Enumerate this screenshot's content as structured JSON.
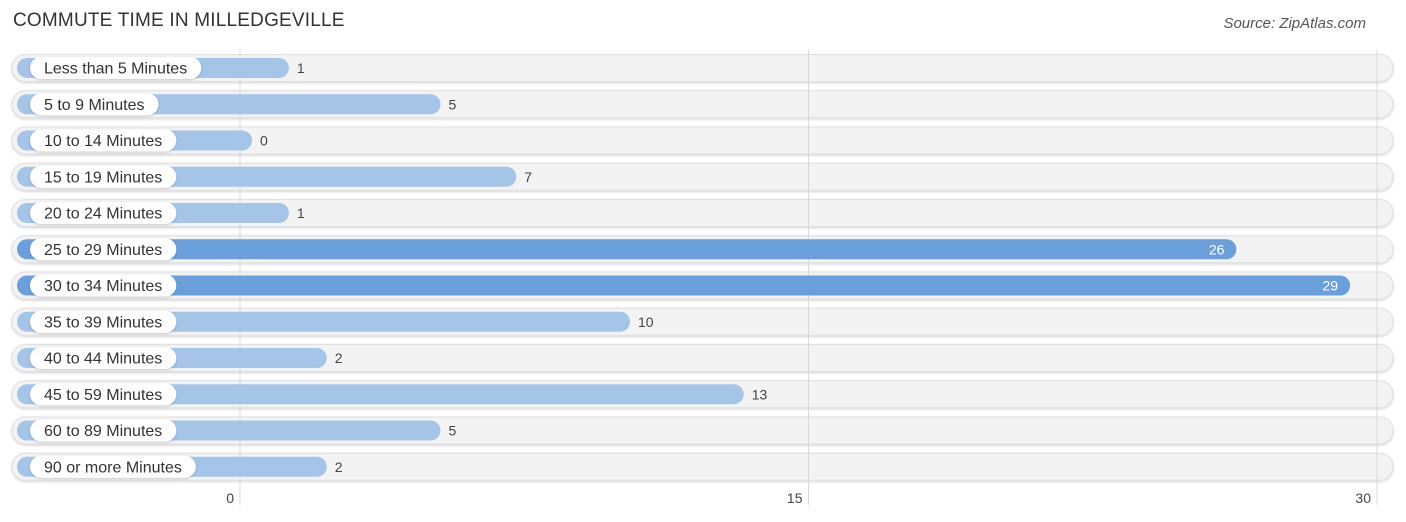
{
  "title": "COMMUTE TIME IN MILLEDGEVILLE",
  "source": "Source: ZipAtlas.com",
  "chart_data": {
    "type": "bar",
    "orientation": "horizontal",
    "title": "COMMUTE TIME IN MILLEDGEVILLE",
    "xlabel": "",
    "ylabel": "",
    "categories": [
      "Less than 5 Minutes",
      "5 to 9 Minutes",
      "10 to 14 Minutes",
      "15 to 19 Minutes",
      "20 to 24 Minutes",
      "25 to 29 Minutes",
      "30 to 34 Minutes",
      "35 to 39 Minutes",
      "40 to 44 Minutes",
      "45 to 59 Minutes",
      "60 to 89 Minutes",
      "90 or more Minutes"
    ],
    "values": [
      1,
      5,
      0,
      7,
      1,
      26,
      29,
      10,
      2,
      13,
      5,
      2
    ],
    "xlim": [
      0,
      30
    ],
    "xticks": [
      0,
      15,
      30
    ],
    "grid": true,
    "colors": {
      "normal": "#a4c4e8",
      "highlight": "#6a9fdc",
      "track": "#f2f2f2"
    }
  }
}
